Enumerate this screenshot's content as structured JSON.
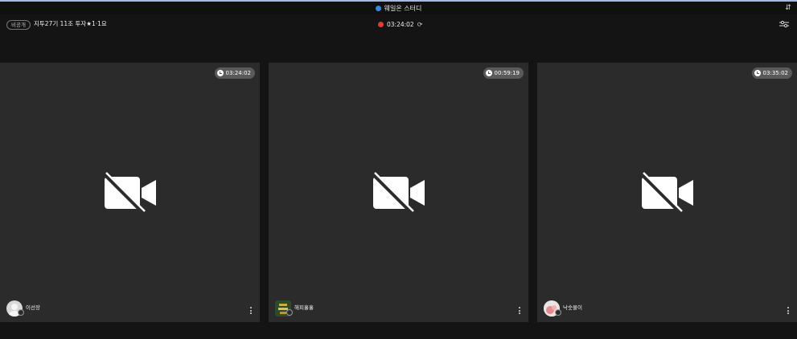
{
  "window": {
    "title": "웨일온 스터디",
    "title_dot_color": "#2f8ae8"
  },
  "room": {
    "privacy_badge": "비공개",
    "name": "지투27기 11조 투자★1·1요",
    "session_time": "03:24:02",
    "rec_color": "#e53935"
  },
  "participants": [
    {
      "name": "이선장",
      "timer": "03:24:02",
      "camera": "off"
    },
    {
      "name": "해피홀홀",
      "timer": "00:59:19",
      "camera": "off"
    },
    {
      "name": "낙숫물이",
      "timer": "03:35:02",
      "camera": "off"
    }
  ],
  "icons": {
    "title_right": "layout-toggle-icon",
    "settings": "settings-sliders-icon",
    "refresh": "refresh-icon",
    "camera_off": "camera-off-icon",
    "more": "more-vertical-icon",
    "clock": "clock-icon"
  }
}
